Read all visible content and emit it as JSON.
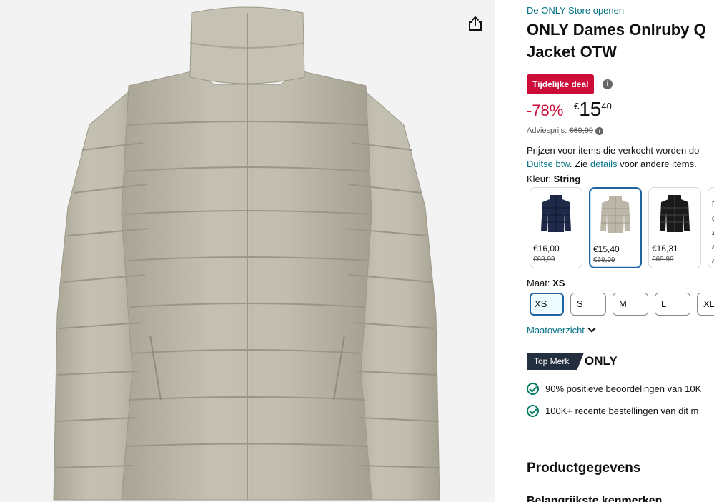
{
  "store_link": "De ONLY Store openen",
  "title": {
    "line1": "ONLY Dames Onlruby Q",
    "line2": "Jacket OTW"
  },
  "deal_badge": "Tijdelijke deal",
  "discount": "-78%",
  "price": {
    "symbol": "€",
    "whole": "15",
    "fraction": "40"
  },
  "list_price": {
    "label": "Adviesprijs:",
    "value": "€69,99"
  },
  "vat_notice": {
    "line1": "Prijzen voor items die verkocht worden do",
    "line2_link1": "Duitse btw",
    "line2_mid": ". Zie ",
    "line2_link2": "details",
    "line2_tail": " voor andere items."
  },
  "color": {
    "label": "Kleur:",
    "selected": "String"
  },
  "swatches": [
    {
      "name": "navy",
      "price": "€16,00",
      "old_price": "€69,99",
      "color": "#1f2a4a"
    },
    {
      "name": "string",
      "price": "€15,40",
      "old_price": "€69,99",
      "color": "#bcb7a8"
    },
    {
      "name": "black",
      "price": "€16,31",
      "old_price": "€69,99",
      "color": "#1a1a1a"
    }
  ],
  "partial_swatch_letters": [
    "E",
    "c",
    "z",
    "a",
    "a"
  ],
  "size": {
    "label": "Maat:",
    "selected": "XS",
    "options": [
      "XS",
      "S",
      "M",
      "L",
      "XL"
    ]
  },
  "size_chart_link": "Maatoverzicht",
  "top_brand": {
    "badge": "Top Merk",
    "brand": "ONLY"
  },
  "highlights": [
    "90% positieve beoordelingen van 10K",
    "100K+ recente bestellingen van dit m"
  ],
  "section_title": "Productgegevens",
  "cut_text": "Belangrijkste kenmerken",
  "colors": {
    "link": "#007185",
    "deal": "#cc0c39",
    "selected_border": "#2162a1",
    "check": "#067d62"
  }
}
